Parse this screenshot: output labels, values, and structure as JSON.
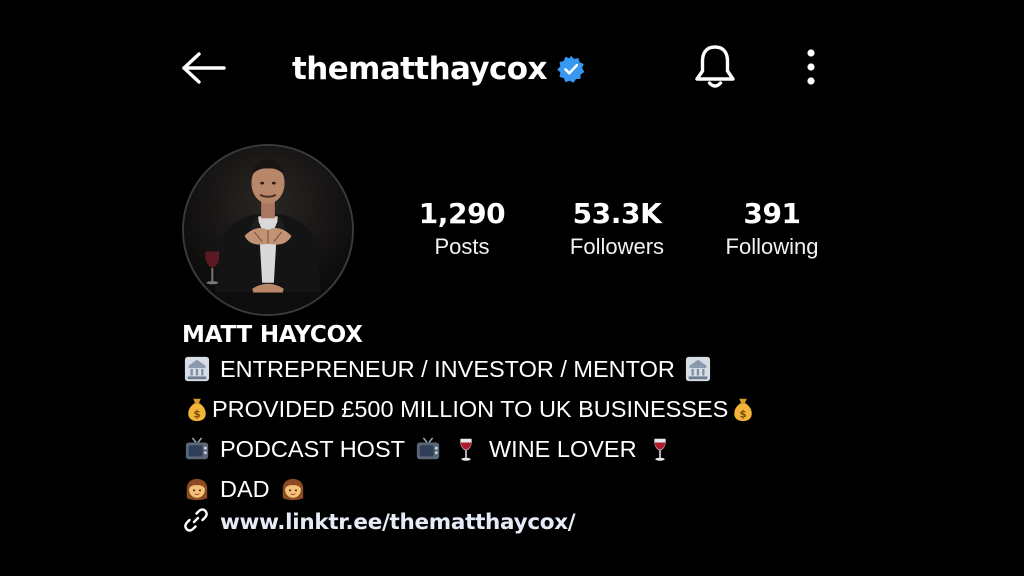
{
  "header": {
    "back_icon": "back-arrow-icon",
    "username": "thematthaycox",
    "verified_icon": "verified-badge-icon",
    "verified_color": "#3897f0",
    "notification_icon": "bell-icon",
    "more_icon": "more-vertical-icon"
  },
  "profile": {
    "avatar_icon": "profile-photo",
    "stats": [
      {
        "value": "1,290",
        "label": "Posts"
      },
      {
        "value": "53.3K",
        "label": "Followers"
      },
      {
        "value": "391",
        "label": "Following"
      }
    ]
  },
  "bio": {
    "display_name": "MATT HAYCOX",
    "line1": "ENTREPRENEUR / INVESTOR / MENTOR",
    "line1_icon": "bank-emoji",
    "line2": "PROVIDED £500 MILLION TO UK BUSINESSES",
    "line2_icon": "money-bag-emoji",
    "line3a": "PODCAST HOST",
    "line3a_icon": "television-emoji",
    "line3b": "WINE LOVER",
    "line3b_icon": "wine-glass-emoji",
    "line4": "DAD",
    "line4_icon": "girl-emoji",
    "link": "www.linktr.ee/thematthaycox/",
    "link_icon": "link-icon"
  },
  "colors": {
    "background": "#000000",
    "text": "#ffffff",
    "verified": "#3897f0"
  }
}
